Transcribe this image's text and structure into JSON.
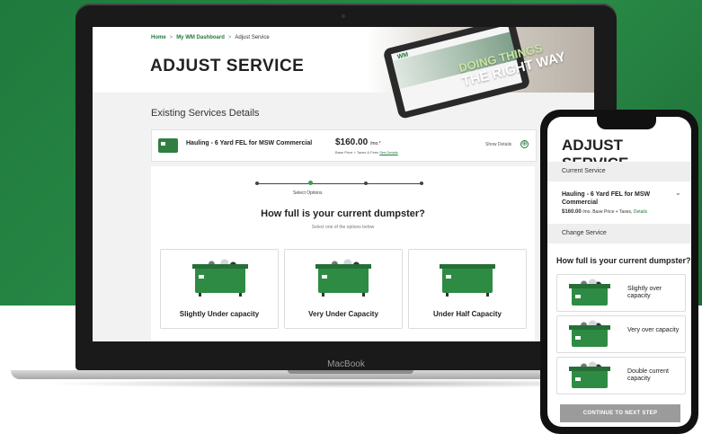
{
  "laptop": {
    "brand": "MacBook",
    "breadcrumb": {
      "home": "Home",
      "dashboard": "My WM Dashboard",
      "current": "Adjust Service",
      "separator": ">"
    },
    "page_title": "ADJUST SERVICE",
    "hero": {
      "tablet_logo": "WM",
      "slogan_line1": "DOING THINGS",
      "slogan_line2": "THE RIGHT WAY"
    },
    "section_title": "Existing Services Details",
    "service": {
      "name": "Hauling - 6 Yard FEL for MSW Commercial",
      "price": "$160.00",
      "price_unit": "/mo.*",
      "note": "Base Price + Taxes & Fees",
      "note_link": "See Details",
      "show_details": "Show Details",
      "plus_icon": "⊕"
    },
    "stepper": {
      "label": "Select Options"
    },
    "question": "How full is your current dumpster?",
    "subquestion": "Select one of the options below",
    "options": [
      {
        "label": "Slightly Under capacity"
      },
      {
        "label": "Very Under Capacity"
      },
      {
        "label": "Under Half Capacity"
      }
    ]
  },
  "phone": {
    "title": "ADJUST SERVICE",
    "current_service_label": "Current Service",
    "service_name": "Hauling - 6 Yard FEL for MSW Commercial",
    "price": "$160.00",
    "price_suffix": "/mo. Base Price + Taxes,",
    "details_link": "Details",
    "chevron_icon": "⌄",
    "change_service_label": "Change Service",
    "question": "How full is your current dumpster?",
    "options": [
      {
        "label": "Slightly over capacity"
      },
      {
        "label": "Very over capacity"
      },
      {
        "label": "Double current capacity"
      }
    ],
    "continue_button": "CONTINUE TO NEXT STEP"
  },
  "colors": {
    "brand_green": "#1f7a3d",
    "accent_green": "#3a9f4f",
    "button_gray": "#9b9b9b"
  }
}
